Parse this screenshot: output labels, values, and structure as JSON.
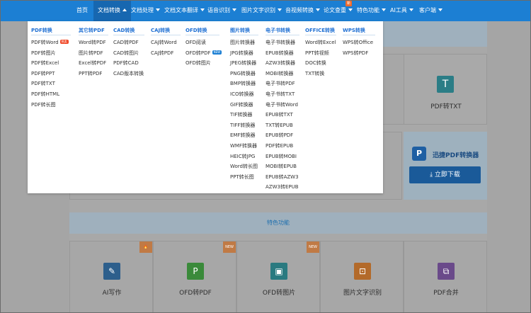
{
  "nav": {
    "items": [
      {
        "label": "首页",
        "caret": ""
      },
      {
        "label": "文档转换",
        "caret": "up"
      },
      {
        "label": "文档处理",
        "caret": "down"
      },
      {
        "label": "文档文本翻译",
        "caret": "down"
      },
      {
        "label": "语音识别",
        "caret": "down"
      },
      {
        "label": "图片文字识别",
        "caret": "down"
      },
      {
        "label": "音视频转换",
        "caret": "down"
      },
      {
        "label": "论文查重",
        "caret": "down"
      },
      {
        "label": "特色功能",
        "caret": "down"
      },
      {
        "label": "AI工具",
        "caret": "down"
      },
      {
        "label": "客户端",
        "caret": "down"
      }
    ],
    "badge_paper": "新"
  },
  "dropdown": {
    "columns": [
      {
        "title": "PDF转换",
        "items": [
          "PDF转Word",
          "PDF转图片",
          "PDF转Excel",
          "PDF转PPT",
          "PDF转TXT",
          "PDF转HTML",
          "PDF转长图"
        ],
        "tags": [
          "hot",
          "",
          "",
          "",
          "",
          "",
          ""
        ]
      },
      {
        "title": "其它转PDF",
        "items": [
          "Word转PDF",
          "图片转PDF",
          "Excel转PDF",
          "PPT转PDF"
        ],
        "tags": [
          "",
          "",
          "",
          ""
        ]
      },
      {
        "title": "CAD转换",
        "items": [
          "CAD转PDF",
          "CAD转图片",
          "PDF转CAD",
          "CAD版本转换"
        ],
        "tags": [
          "",
          "",
          "",
          ""
        ]
      },
      {
        "title": "CAJ转换",
        "items": [
          "CAJ转Word",
          "CAJ转PDF"
        ],
        "tags": [
          "",
          ""
        ]
      },
      {
        "title": "OFD转换",
        "items": [
          "OFD阅读",
          "OFD转PDF",
          "OFD转图片"
        ],
        "tags": [
          "",
          "new",
          ""
        ]
      },
      {
        "title": "图片转换",
        "items": [
          "图片转换器",
          "JPG转换器",
          "JPEG转换器",
          "PNG转换器",
          "BMP转换器",
          "ICO转换器",
          "GIF转换器",
          "TIF转换器",
          "TIFF转换器",
          "EMF转换器",
          "WMF转换器",
          "HEIC转JPG",
          "Word转长图",
          "PPT转长图"
        ],
        "tags": [
          "",
          "",
          "",
          "",
          "",
          "",
          "",
          "",
          "",
          "",
          "",
          "",
          "",
          ""
        ]
      },
      {
        "title": "电子书转换",
        "items": [
          "电子书转换器",
          "EPUB转换器",
          "AZW3转换器",
          "MOBI转换器",
          "电子书转PDF",
          "电子书转TXT",
          "电子书转Word",
          "EPUB转TXT",
          "TXT转EPUB",
          "EPUB转PDF",
          "PDF转EPUB",
          "EPUB转MOBI",
          "MOBI转EPUB",
          "EPUB转AZW3",
          "AZW3转EPUB"
        ],
        "tags": [
          "",
          "",
          "",
          "",
          "",
          "",
          "",
          "",
          "",
          "",
          "",
          "",
          "",
          "",
          ""
        ]
      },
      {
        "title": "OFFICE转换",
        "items": [
          "Word转Excel",
          "PPT转视频",
          "DOC转换",
          "TXT转换"
        ],
        "tags": [
          "",
          "",
          "",
          ""
        ]
      },
      {
        "title": "WPS转换",
        "items": [
          "WPS转Office",
          "WPS转PDF"
        ],
        "tags": [
          "",
          ""
        ]
      }
    ],
    "tag_new_label": "NEW",
    "tag_hot_label": "热卖"
  },
  "background": {
    "card_pdf_txt": "PDF转TXT",
    "promo_title": "迅捷PDF转换器",
    "promo_logo": "P",
    "promo_button": "立即下载",
    "section_title": "特色功能",
    "features": [
      {
        "label": "AI写作",
        "badge": "",
        "color": "#2d5f8c"
      },
      {
        "label": "OFD转PDF",
        "badge": "NEW",
        "color": "#3a8a3a"
      },
      {
        "label": "OFD转图片",
        "badge": "NEW",
        "color": "#2a7a80"
      },
      {
        "label": "图片文字识别",
        "badge": "",
        "color": "#b36a2a"
      },
      {
        "label": "PDF合并",
        "badge": "",
        "color": "#6a4a8a"
      }
    ]
  }
}
